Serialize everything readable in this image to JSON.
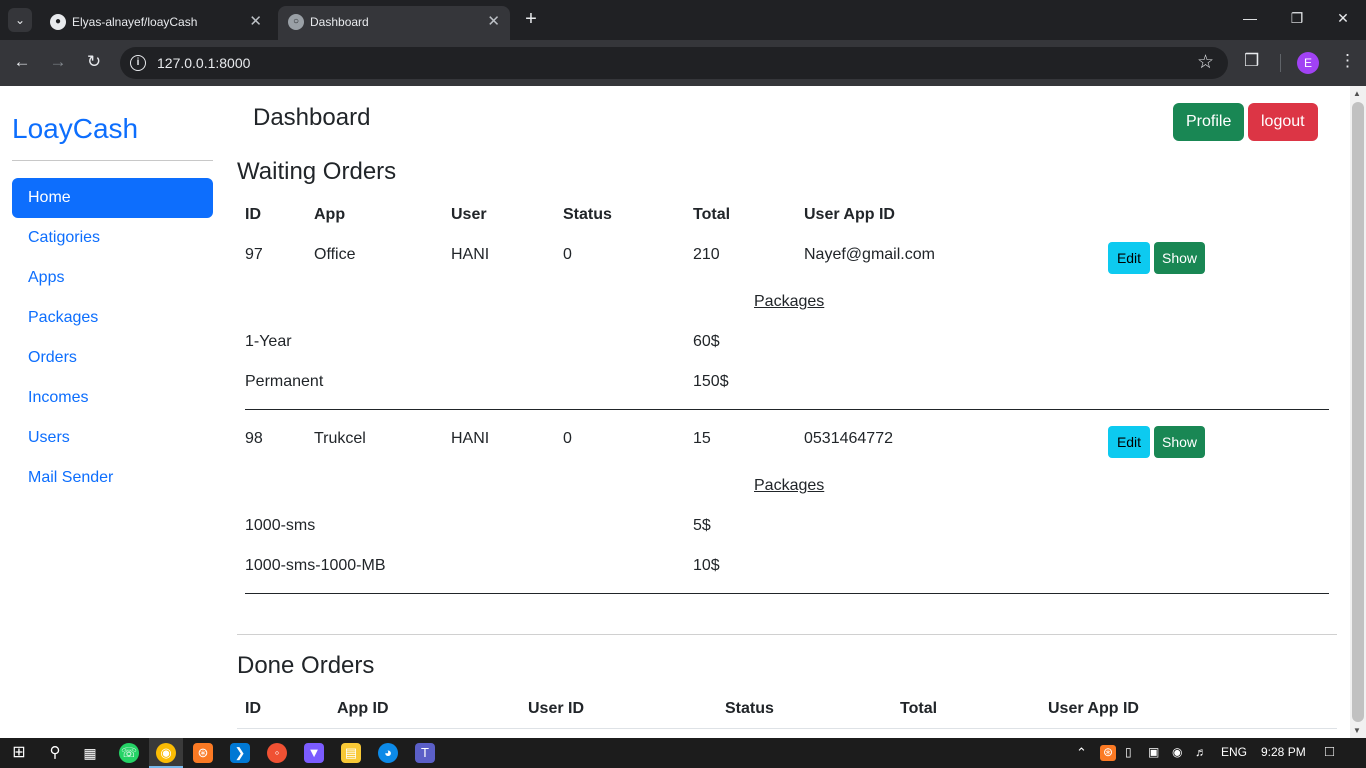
{
  "browser": {
    "tabs": [
      {
        "title": "Elyas-alnayef/loayCash",
        "icon": "github-icon"
      },
      {
        "title": "Dashboard",
        "icon": "globe-icon"
      }
    ],
    "url": "127.0.0.1:8000",
    "profile_initial": "E"
  },
  "sidebar": {
    "brand": "LoayCash",
    "items": [
      {
        "label": "Home",
        "active": true
      },
      {
        "label": "Catigories"
      },
      {
        "label": "Apps"
      },
      {
        "label": "Packages"
      },
      {
        "label": "Orders"
      },
      {
        "label": "Incomes"
      },
      {
        "label": "Users"
      },
      {
        "label": "Mail Sender"
      }
    ]
  },
  "header": {
    "title": "Dashboard",
    "profile_label": "Profile",
    "logout_label": "logout"
  },
  "waiting": {
    "title": "Waiting Orders",
    "headers": [
      "ID",
      "App",
      "User",
      "Status",
      "Total",
      "User App ID"
    ],
    "packages_label": "Packages",
    "edit_label": "Edit",
    "show_label": "Show",
    "orders": [
      {
        "cells": [
          "97",
          "Office",
          "HANI",
          "0",
          "210",
          "Nayef@gmail.com"
        ],
        "packages": [
          {
            "name": "1-Year",
            "price": "60$"
          },
          {
            "name": "Permanent",
            "price": "150$"
          }
        ]
      },
      {
        "cells": [
          "98",
          "Trukcel",
          "HANI",
          "0",
          "15",
          "0531464772"
        ],
        "packages": [
          {
            "name": "1000-sms",
            "price": "5$"
          },
          {
            "name": "1000-sms-1000-MB",
            "price": "10$"
          }
        ]
      }
    ]
  },
  "done": {
    "title": "Done Orders",
    "headers": [
      "ID",
      "App ID",
      "User ID",
      "Status",
      "Total",
      "User App ID"
    ]
  },
  "taskbar": {
    "language": "ENG",
    "time": "9:28 PM"
  },
  "colors": {
    "primary": "#0d6efd",
    "success": "#198754",
    "danger": "#dc3545",
    "info": "#0dcaf0"
  }
}
